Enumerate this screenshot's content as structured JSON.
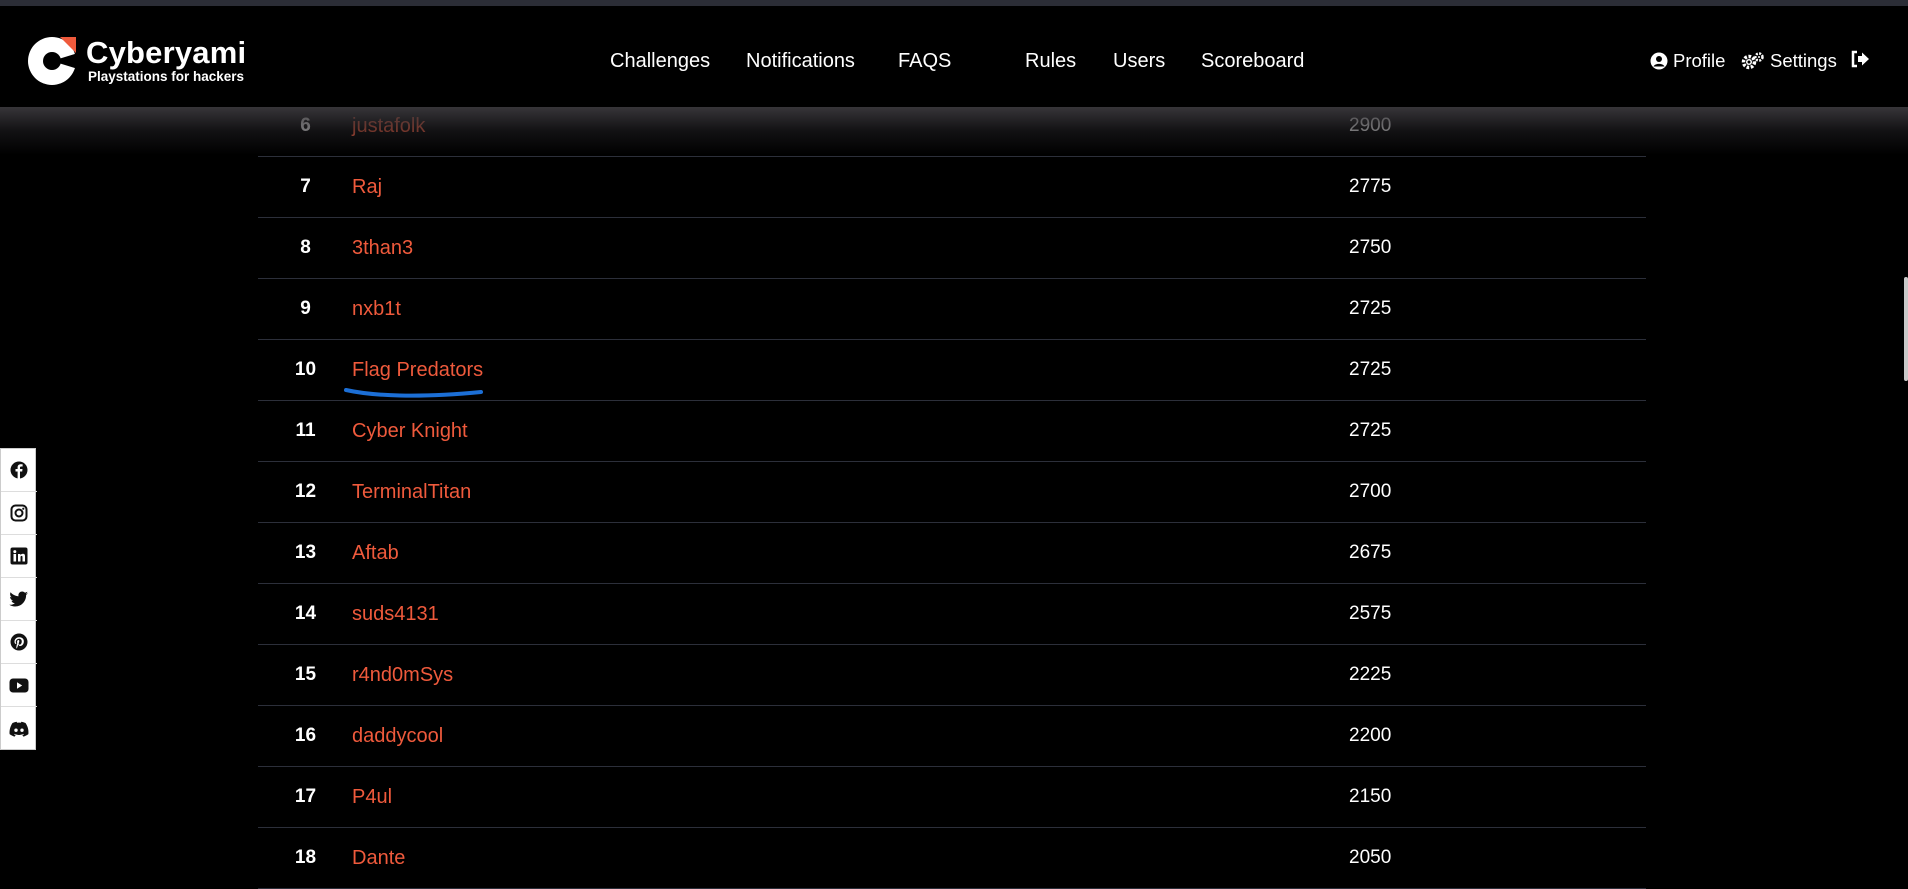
{
  "brand": {
    "name": "Cyberyami",
    "tagline": "Playstations for hackers"
  },
  "nav": {
    "items": [
      {
        "label": "Challenges"
      },
      {
        "label": "Notifications"
      },
      {
        "label": "FAQS"
      },
      {
        "label": "Rules"
      },
      {
        "label": "Users"
      },
      {
        "label": "Scoreboard"
      }
    ],
    "profile_label": "Profile",
    "settings_label": "Settings"
  },
  "scoreboard": {
    "rows": [
      {
        "rank": "6",
        "team": "justafolk",
        "score": "2900"
      },
      {
        "rank": "7",
        "team": "Raj",
        "score": "2775"
      },
      {
        "rank": "8",
        "team": "3than3",
        "score": "2750"
      },
      {
        "rank": "9",
        "team": "nxb1t",
        "score": "2725"
      },
      {
        "rank": "10",
        "team": "Flag Predators",
        "score": "2725"
      },
      {
        "rank": "11",
        "team": "Cyber Knight",
        "score": "2725"
      },
      {
        "rank": "12",
        "team": "TerminalTitan",
        "score": "2700"
      },
      {
        "rank": "13",
        "team": "Aftab",
        "score": "2675"
      },
      {
        "rank": "14",
        "team": "suds4131",
        "score": "2575"
      },
      {
        "rank": "15",
        "team": "r4nd0mSys",
        "score": "2225"
      },
      {
        "rank": "16",
        "team": "daddycool",
        "score": "2200"
      },
      {
        "rank": "17",
        "team": "P4ul",
        "score": "2150"
      },
      {
        "rank": "18",
        "team": "Dante",
        "score": "2050"
      }
    ]
  },
  "social": [
    "facebook-icon",
    "instagram-icon",
    "linkedin-icon",
    "twitter-icon",
    "pinterest-icon",
    "youtube-icon",
    "discord-icon"
  ],
  "colors": {
    "accent": "#ef5a3c",
    "background": "#000000",
    "annotation": "#1c6fd6"
  }
}
